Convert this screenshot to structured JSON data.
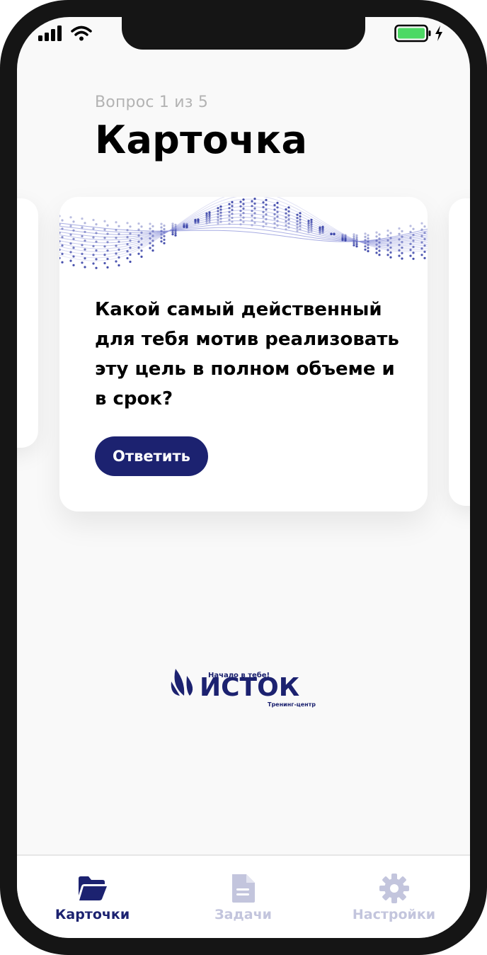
{
  "header": {
    "subtitle": "Вопрос 1 из 5",
    "title": "Карточка"
  },
  "card": {
    "question": "Какой самый действенный для тебя мотив реализовать эту цель в полном объеме и в срок?",
    "answer_button": "Ответить"
  },
  "logo": {
    "name": "ИСТОК",
    "tagline": "Начало в тебе!",
    "subtitle": "Тренинг-центр"
  },
  "tabs": [
    {
      "label": "Карточки",
      "icon": "folder-icon",
      "active": true
    },
    {
      "label": "Задачи",
      "icon": "document-icon",
      "active": false
    },
    {
      "label": "Настройки",
      "icon": "gear-icon",
      "active": false
    }
  ],
  "colors": {
    "accent": "#1c2270",
    "inactive_tab": "#c3c5dd",
    "battery": "#4cd964"
  }
}
